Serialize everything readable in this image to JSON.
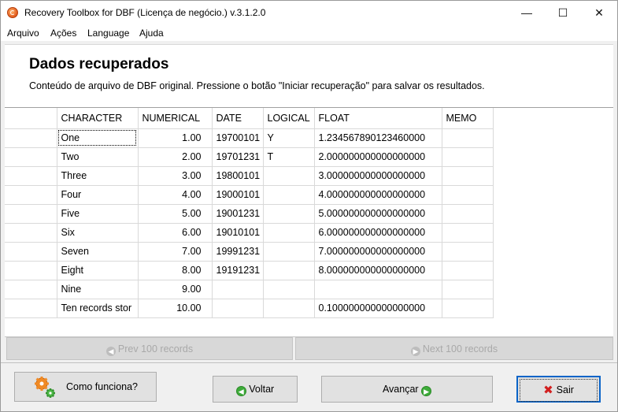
{
  "window": {
    "title": "Recovery Toolbox for DBF (Licença de negócio.) v.3.1.2.0"
  },
  "menu": [
    "Arquivo",
    "Ações",
    "Language",
    "Ajuda"
  ],
  "page": {
    "heading": "Dados recuperados",
    "subtitle": "Conteúdo de arquivo de DBF original. Pressione o botão \"Iniciar recuperação\" para salvar os resultados."
  },
  "grid": {
    "columns": [
      "CHARACTER",
      "NUMERICAL",
      "DATE",
      "LOGICAL",
      "FLOAT",
      "MEMO"
    ],
    "rows": [
      [
        "One",
        "1.00",
        "19700101",
        "Y",
        "1.234567890123460000",
        ""
      ],
      [
        "Two",
        "2.00",
        "19701231",
        "T",
        "2.000000000000000000",
        ""
      ],
      [
        "Three",
        "3.00",
        "19800101",
        "",
        "3.000000000000000000",
        ""
      ],
      [
        "Four",
        "4.00",
        "19000101",
        "",
        "4.000000000000000000",
        ""
      ],
      [
        "Five",
        "5.00",
        "19001231",
        "",
        "5.000000000000000000",
        ""
      ],
      [
        "Six",
        "6.00",
        "19010101",
        "",
        "6.000000000000000000",
        ""
      ],
      [
        "Seven",
        "7.00",
        "19991231",
        "",
        "7.000000000000000000",
        ""
      ],
      [
        "Eight",
        "8.00",
        "19191231",
        "",
        "8.000000000000000000",
        ""
      ],
      [
        "Nine",
        "9.00",
        "",
        "",
        "",
        ""
      ],
      [
        "Ten records stor",
        "10.00",
        "",
        "",
        "0.100000000000000000",
        ""
      ]
    ]
  },
  "nav": {
    "prev": "Prev 100 records",
    "next": "Next 100 records"
  },
  "buttons": {
    "how": "Como funciona?",
    "back": "Voltar",
    "next": "Avançar",
    "exit": "Sair"
  },
  "colors": {
    "accent_green": "#3eab3a",
    "exit_red": "#d21f1f",
    "focus_blue": "#0a64c8"
  }
}
